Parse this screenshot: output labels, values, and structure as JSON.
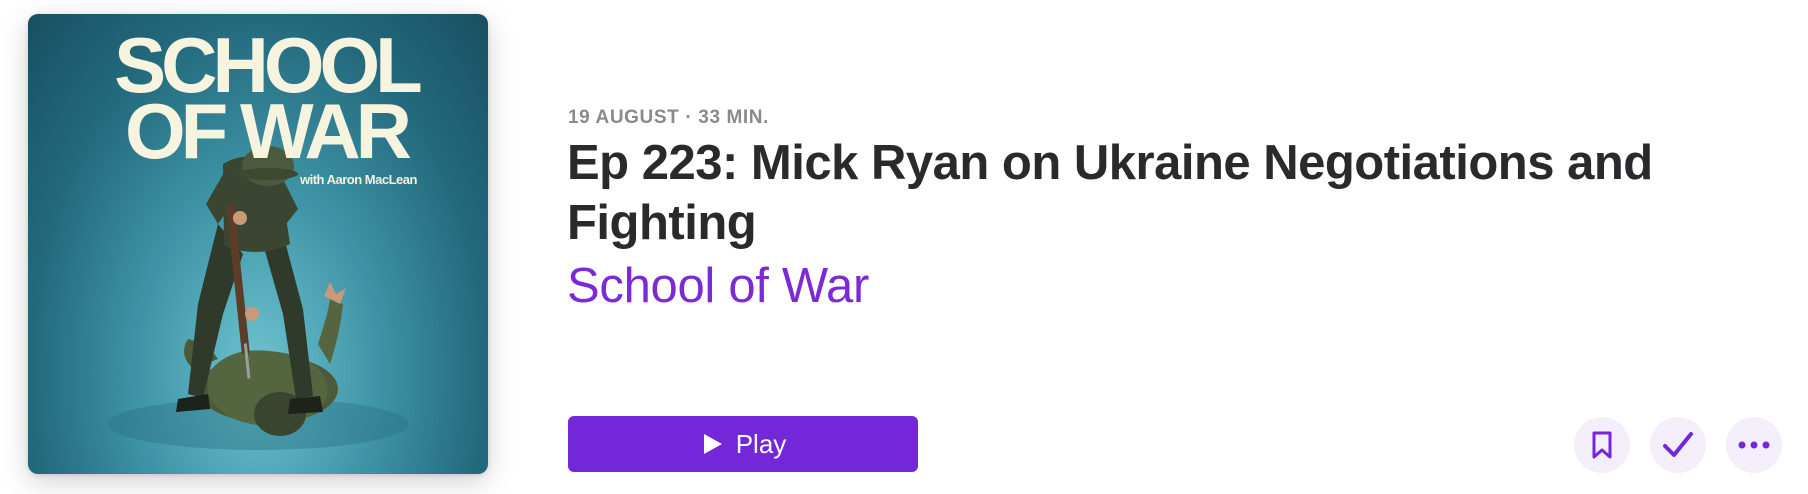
{
  "episode": {
    "date": "19 AUGUST",
    "separator": "·",
    "duration": "33 MIN.",
    "title": "Ep 223: Mick Ryan on Ukraine Negotiations and Fighting",
    "show_name": "School of War"
  },
  "artwork": {
    "title_line1": "SCHOOL",
    "title_line2": "OF WAR",
    "subtitle": "with Aaron MacLean"
  },
  "actions": {
    "play_label": "Play",
    "play_icon": "play-icon",
    "save_icon": "bookmark-icon",
    "played_icon": "checkmark-icon",
    "more_icon": "ellipsis-icon"
  },
  "colors": {
    "accent": "#7427d9",
    "show_link": "#7b2ad6",
    "title": "#2a2a2c",
    "meta": "#8a8a8e",
    "circle_bg": "#f3eefa"
  }
}
